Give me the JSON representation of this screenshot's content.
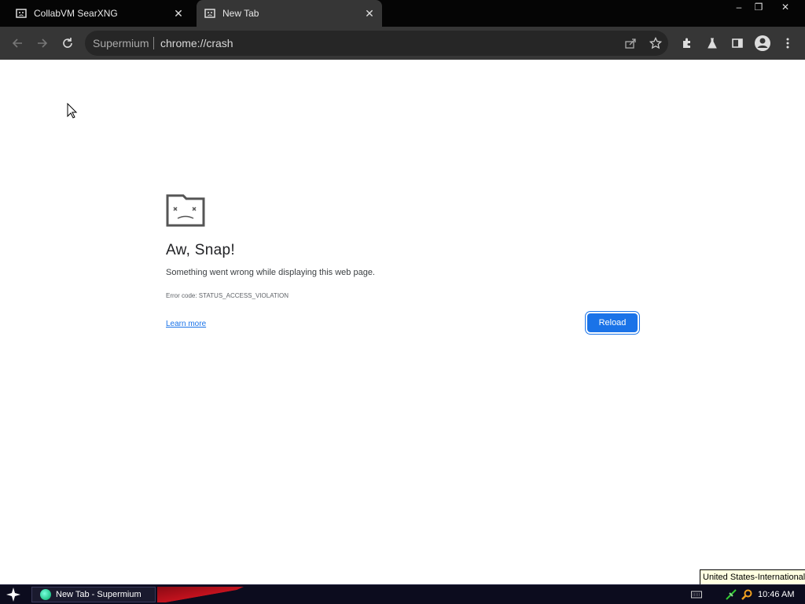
{
  "browser": {
    "tabs": [
      {
        "label": "CollabVM SearXNG",
        "close": "✕"
      },
      {
        "label": "New Tab",
        "close": "✕"
      }
    ],
    "window_controls": {
      "minimize": "–",
      "restore": "❐",
      "close": "✕"
    },
    "omnibox": {
      "label": "Supermium",
      "url": "chrome://crash"
    }
  },
  "error_page": {
    "headline": "Aw, Snap!",
    "description": "Something went wrong while displaying this web page.",
    "error_code": "Error code: STATUS_ACCESS_VIOLATION",
    "learn_more": "Learn more",
    "reload": "Reload"
  },
  "taskbar": {
    "task_label": "New Tab - Supermium",
    "clock": "10:46 AM",
    "keyboard_tooltip": "United States-International"
  },
  "colors": {
    "accent": "#1a73e8",
    "tabbar": "#050505",
    "toolbar": "#363636"
  }
}
